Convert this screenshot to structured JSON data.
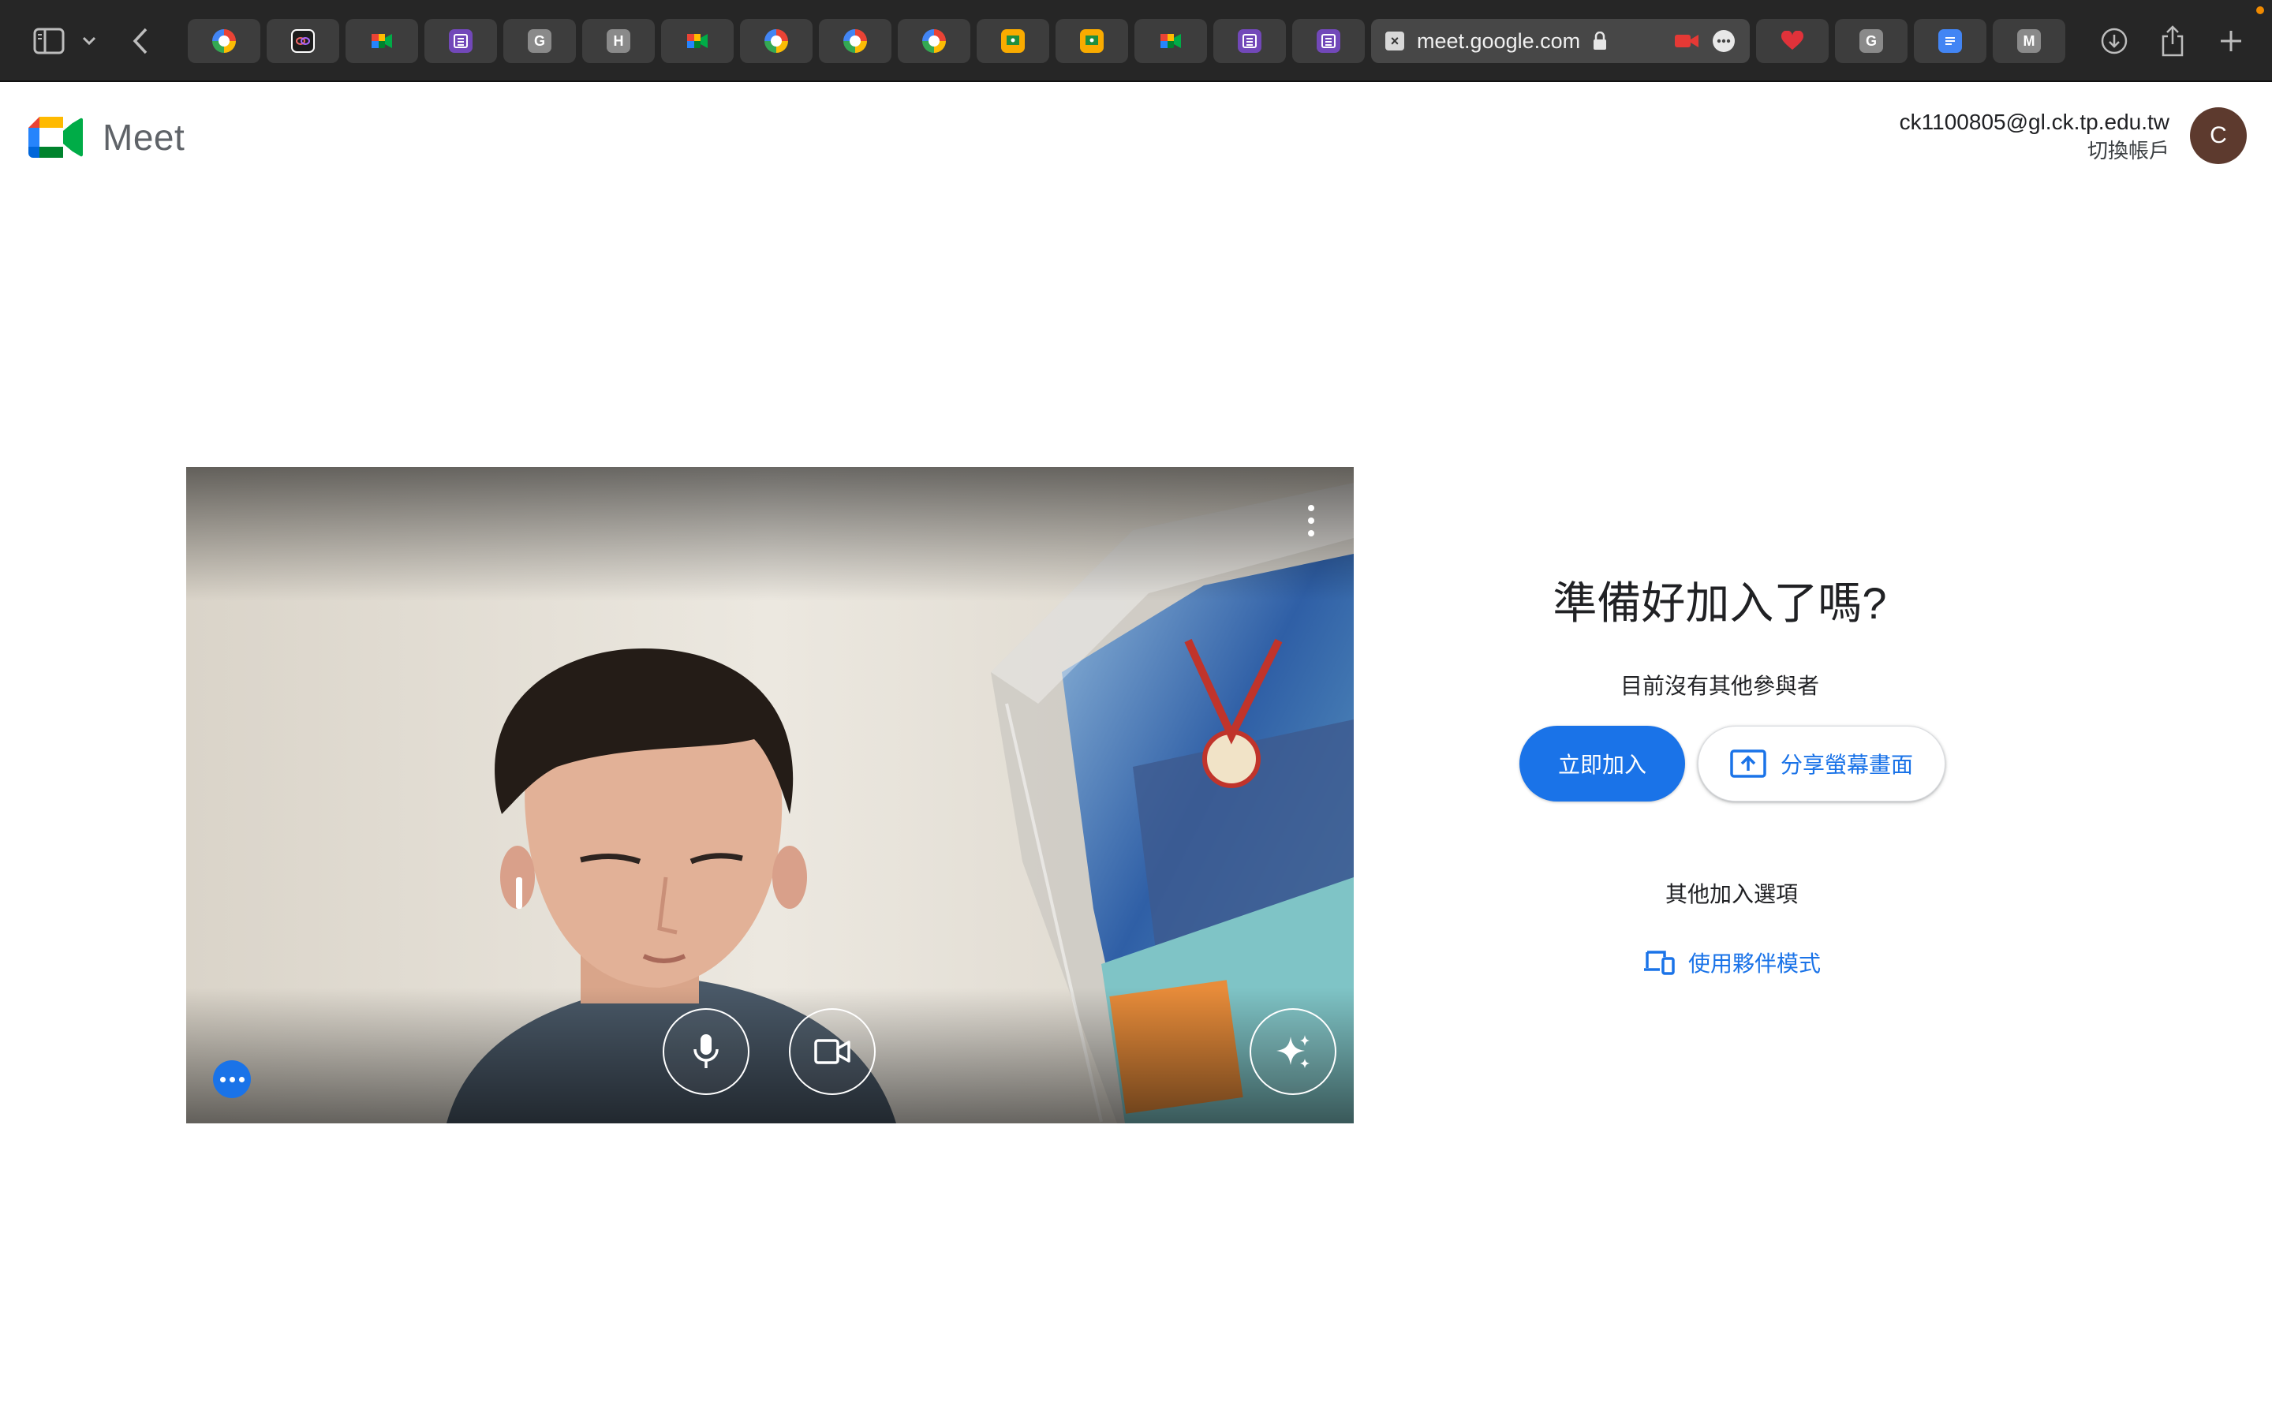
{
  "browser": {
    "url": "meet.google.com",
    "tabs": [
      {
        "icon": "google-icon",
        "letter": ""
      },
      {
        "icon": "creative-cloud-icon",
        "letter": ""
      },
      {
        "icon": "google-meet-icon",
        "letter": ""
      },
      {
        "icon": "google-forms-icon",
        "letter": ""
      },
      {
        "icon": "letter-g-icon",
        "letter": "G"
      },
      {
        "icon": "letter-h-icon",
        "letter": "H"
      },
      {
        "icon": "google-meet-icon",
        "letter": ""
      },
      {
        "icon": "google-icon",
        "letter": ""
      },
      {
        "icon": "google-icon",
        "letter": ""
      },
      {
        "icon": "google-icon",
        "letter": ""
      },
      {
        "icon": "google-classroom-icon",
        "letter": ""
      },
      {
        "icon": "google-classroom-icon",
        "letter": ""
      },
      {
        "icon": "google-meet-icon",
        "letter": ""
      },
      {
        "icon": "google-forms-icon",
        "letter": ""
      },
      {
        "icon": "google-forms-icon",
        "letter": ""
      }
    ],
    "tabs_after": [
      {
        "icon": "heart-icon",
        "letter": ""
      },
      {
        "icon": "letter-g-icon",
        "letter": "G"
      },
      {
        "icon": "google-docs-icon",
        "letter": ""
      },
      {
        "icon": "letter-m-icon",
        "letter": "M"
      }
    ]
  },
  "header": {
    "app_name": "Meet",
    "account_email": "ck1100805@gl.ck.tp.edu.tw",
    "switch_account": "切換帳戶",
    "avatar_letter": "C"
  },
  "join": {
    "title": "準備好加入了嗎?",
    "subtitle": "目前沒有其他參與者",
    "join_button": "立即加入",
    "share_button": "分享螢幕畫面",
    "other_options": "其他加入選項",
    "companion_mode": "使用夥伴模式"
  },
  "colors": {
    "accent": "#1a73e8",
    "chrome_bg": "#262626",
    "avatar_bg": "#5d3a2e"
  }
}
